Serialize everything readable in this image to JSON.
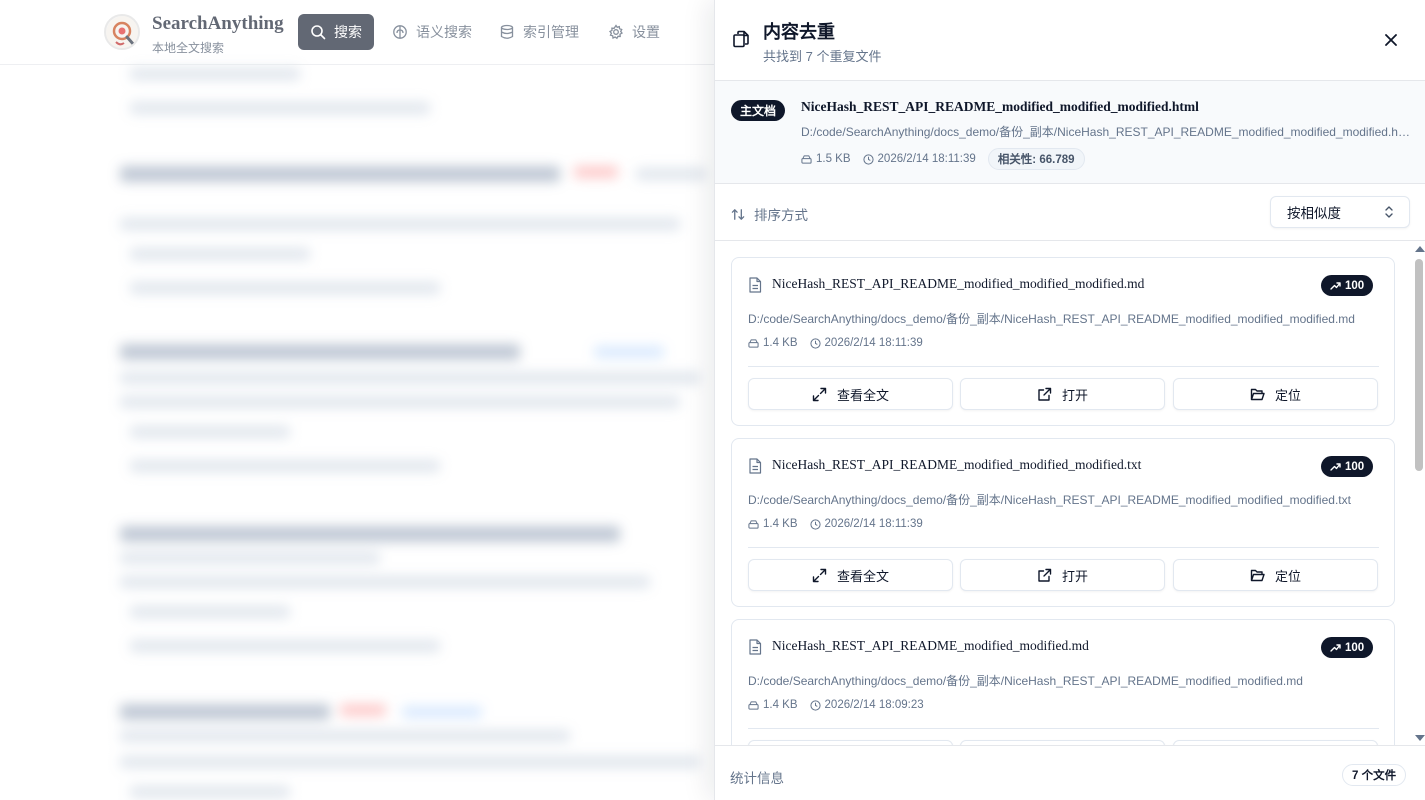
{
  "app": {
    "name": "SearchAnything",
    "subtitle": "本地全文搜索",
    "nav": [
      {
        "label": "搜索",
        "icon": "search-icon",
        "active": true
      },
      {
        "label": "语义搜索",
        "icon": "brain-icon",
        "active": false
      },
      {
        "label": "索引管理",
        "icon": "database-icon",
        "active": false
      },
      {
        "label": "设置",
        "icon": "gear-icon",
        "active": false
      }
    ]
  },
  "panel": {
    "title": "内容去重",
    "subtitle": "共找到 7 个重复文件",
    "primary": {
      "badge": "主文档",
      "name": "NiceHash_REST_API_README_modified_modified_modified.html",
      "path": "D:/code/SearchAnything/docs_demo/备份_副本/NiceHash_REST_API_README_modified_modified_modified.html",
      "size": "1.5 KB",
      "time": "2026/2/14 18:11:39",
      "relevance": "相关性: 66.789"
    },
    "sort": {
      "label": "排序方式",
      "selected": "按相似度"
    },
    "actions": {
      "view": "查看全文",
      "open": "打开",
      "locate": "定位"
    },
    "duplicates": [
      {
        "name": "NiceHash_REST_API_README_modified_modified_modified.md",
        "path": "D:/code/SearchAnything/docs_demo/备份_副本/NiceHash_REST_API_README_modified_modified_modified.md",
        "size": "1.4 KB",
        "time": "2026/2/14 18:11:39",
        "score": "100"
      },
      {
        "name": "NiceHash_REST_API_README_modified_modified_modified.txt",
        "path": "D:/code/SearchAnything/docs_demo/备份_副本/NiceHash_REST_API_README_modified_modified_modified.txt",
        "size": "1.4 KB",
        "time": "2026/2/14 18:11:39",
        "score": "100"
      },
      {
        "name": "NiceHash_REST_API_README_modified_modified.md",
        "path": "D:/code/SearchAnything/docs_demo/备份_副本/NiceHash_REST_API_README_modified_modified.md",
        "size": "1.4 KB",
        "time": "2026/2/14 18:09:23",
        "score": "100"
      }
    ],
    "footer": {
      "label": "统计信息",
      "count": "7 个文件"
    }
  },
  "colors": {
    "primary": "#0f172a",
    "muted": "#64748b",
    "border": "#e2e8f0",
    "panel_bg": "#f8fafc"
  }
}
